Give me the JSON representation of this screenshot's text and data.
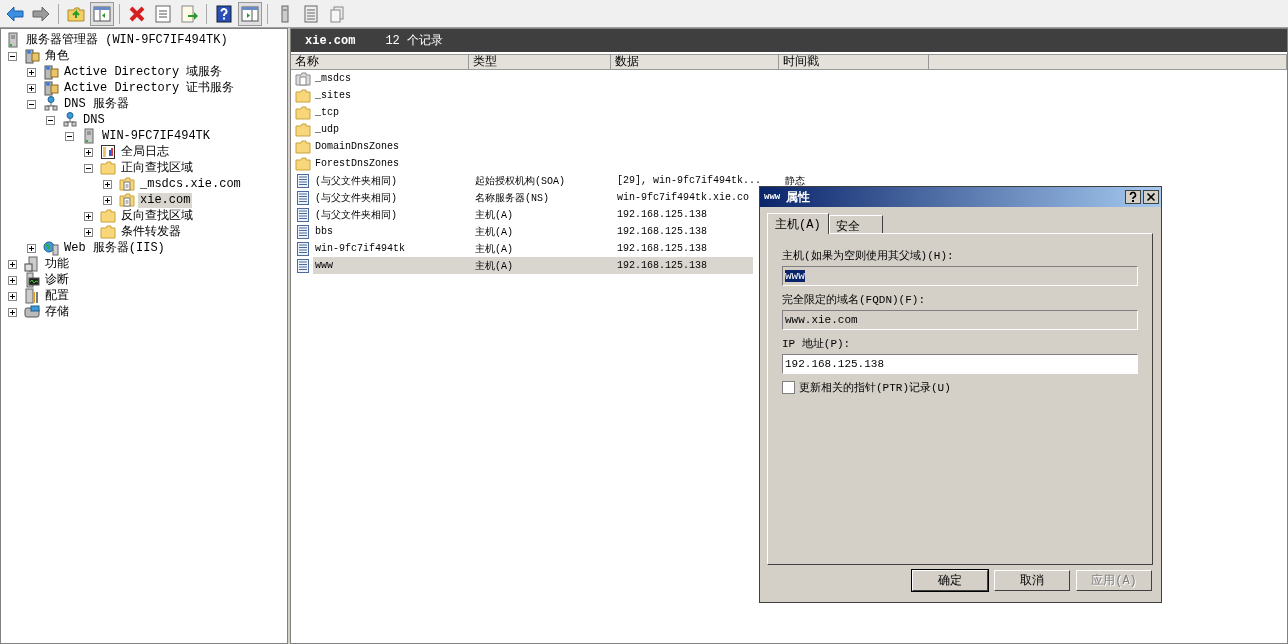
{
  "tree": {
    "label": "服务器管理器 (WIN-9FC7IF494TK)",
    "kind": "manager",
    "children": [
      {
        "label": "角色",
        "kind": "roles",
        "expanded": true,
        "selected": false,
        "children": [
          {
            "label": "Active Directory 域服务",
            "kind": "directory",
            "expanded": false,
            "selected": false
          },
          {
            "label": "Active Directory 证书服务",
            "kind": "directory",
            "expanded": false,
            "selected": false
          },
          {
            "label": "DNS 服务器",
            "kind": "dns",
            "expanded": true,
            "selected": false,
            "children": [
              {
                "label": "DNS",
                "kind": "dns",
                "expanded": true,
                "selected": false,
                "children": [
                  {
                    "label": "WIN-9FC7IF494TK",
                    "kind": "server",
                    "expanded": true,
                    "selected": false,
                    "children": [
                      {
                        "label": "全局日志",
                        "kind": "log",
                        "expanded": false,
                        "selected": false
                      },
                      {
                        "label": "正向查找区域",
                        "kind": "folder",
                        "expanded": true,
                        "selected": false,
                        "children": [
                          {
                            "label": "_msdcs.xie.com",
                            "kind": "zone",
                            "expanded": false,
                            "selected": false
                          },
                          {
                            "label": "xie.com",
                            "kind": "zone",
                            "expanded": false,
                            "selected": true
                          }
                        ]
                      },
                      {
                        "label": "反向查找区域",
                        "kind": "folder",
                        "expanded": false,
                        "selected": false
                      },
                      {
                        "label": "条件转发器",
                        "kind": "folder",
                        "expanded": false,
                        "selected": false
                      }
                    ]
                  }
                ]
              }
            ]
          },
          {
            "label": "Web 服务器(IIS)",
            "kind": "web",
            "expanded": false,
            "selected": false
          }
        ]
      },
      {
        "label": "功能",
        "kind": "features",
        "expanded": false,
        "selected": false
      },
      {
        "label": "诊断",
        "kind": "diagnostics",
        "expanded": false,
        "selected": false
      },
      {
        "label": "配置",
        "kind": "config",
        "expanded": false,
        "selected": false
      },
      {
        "label": "存储",
        "kind": "storage",
        "expanded": false,
        "selected": false
      }
    ]
  },
  "list": {
    "title": "xie.com",
    "count": "12 个记录",
    "columns": [
      "名称",
      "类型",
      "数据",
      "时间戳"
    ],
    "rows": [
      {
        "kind": "delegation",
        "name": "_msdcs",
        "selected": false
      },
      {
        "kind": "folder",
        "name": "_sites",
        "selected": false
      },
      {
        "kind": "folder",
        "name": "_tcp",
        "selected": false
      },
      {
        "kind": "folder",
        "name": "_udp",
        "selected": false
      },
      {
        "kind": "folder",
        "name": "DomainDnsZones",
        "selected": false
      },
      {
        "kind": "folder",
        "name": "ForestDnsZones",
        "selected": false
      },
      {
        "kind": "record",
        "name": "(与父文件夹相同)",
        "type": "起始授权机构(SOA)",
        "data": "[29], win-9fc7if494tk...",
        "timestamp": "静态",
        "selected": false
      },
      {
        "kind": "record",
        "name": "(与父文件夹相同)",
        "type": "名称服务器(NS)",
        "data": "win-9fc7if494tk.xie.co",
        "selected": false
      },
      {
        "kind": "record",
        "name": "(与父文件夹相同)",
        "type": "主机(A)",
        "data": "192.168.125.138",
        "selected": false
      },
      {
        "kind": "record",
        "name": "bbs",
        "type": "主机(A)",
        "data": "192.168.125.138",
        "selected": false
      },
      {
        "kind": "record",
        "name": "win-9fc7if494tk",
        "type": "主机(A)",
        "data": "192.168.125.138",
        "selected": false
      },
      {
        "kind": "record",
        "name": "www",
        "type": "主机(A)",
        "data": "192.168.125.138",
        "selected": true
      }
    ]
  },
  "dialog": {
    "title_name": "www",
    "title": "属性",
    "tabs": [
      {
        "label": "主机(A)",
        "selected": true
      },
      {
        "label": "安全",
        "selected": false
      }
    ],
    "fields": [
      {
        "label": "主机(如果为空则使用其父域)(H):",
        "value": "www",
        "readonly": true,
        "highlighted": true
      },
      {
        "label": "完全限定的域名(FQDN)(F):",
        "value": "www.xie.com",
        "readonly": true,
        "highlighted": false
      },
      {
        "label": "IP 地址(P):",
        "value": "192.168.125.138",
        "readonly": false,
        "highlighted": false
      }
    ],
    "checkbox": {
      "label": "更新相关的指针(PTR)记录(U)",
      "checked": false
    },
    "buttons": [
      {
        "label": "确定",
        "default": true,
        "disabled": false
      },
      {
        "label": "取消",
        "default": false,
        "disabled": false
      },
      {
        "label": "应用(A)",
        "default": false,
        "disabled": true
      }
    ]
  }
}
